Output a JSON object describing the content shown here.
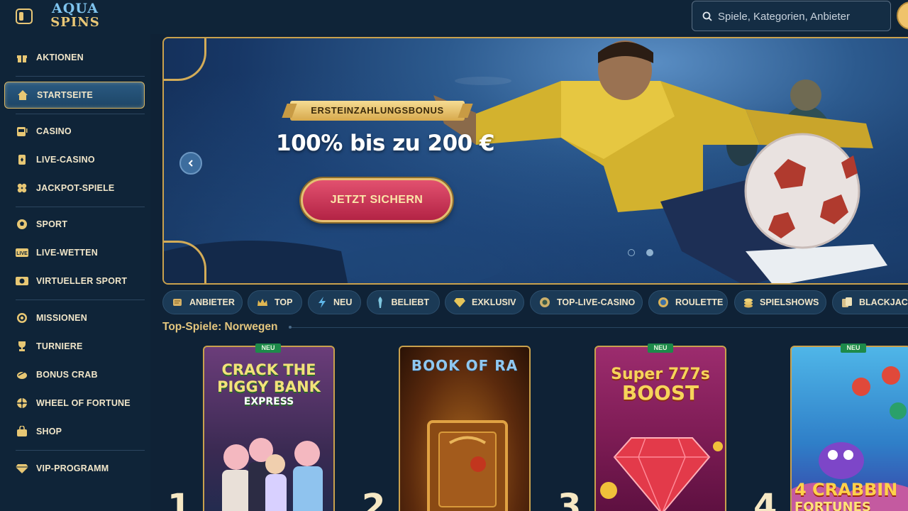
{
  "header": {
    "logo_line1": "AQUA",
    "logo_line2": "SPINS",
    "search_placeholder": "Spiele, Kategorien, Anbieter"
  },
  "sidebar": {
    "items": [
      {
        "label": "AKTIONEN",
        "icon": "gift-icon"
      },
      {
        "label": "STARTSEITE",
        "icon": "home-icon",
        "active": true
      },
      {
        "label": "CASINO",
        "icon": "slot-machine-icon"
      },
      {
        "label": "LIVE-CASINO",
        "icon": "card-icon"
      },
      {
        "label": "JACKPOT-SPIELE",
        "icon": "clover-icon"
      },
      {
        "label": "SPORT",
        "icon": "soccer-ball-icon"
      },
      {
        "label": "LIVE-WETTEN",
        "icon": "live-icon"
      },
      {
        "label": "VIRTUELLER SPORT",
        "icon": "screen-ball-icon"
      },
      {
        "label": "MISSIONEN",
        "icon": "target-icon"
      },
      {
        "label": "TURNIERE",
        "icon": "trophy-icon"
      },
      {
        "label": "BONUS CRAB",
        "icon": "claw-icon"
      },
      {
        "label": "WHEEL OF FORTUNE",
        "icon": "wheel-icon"
      },
      {
        "label": "SHOP",
        "icon": "bag-icon"
      },
      {
        "label": "VIP-PROGRAMM",
        "icon": "diamond-icon"
      }
    ]
  },
  "hero": {
    "badge": "ERSTEINZAHLUNGSBONUS",
    "title": "100% bis zu 200 €",
    "cta": "JETZT SICHERN",
    "slides": 2,
    "active_slide": 2
  },
  "tabs": [
    {
      "label": "ANBIETER",
      "icon": "scroll-icon"
    },
    {
      "label": "TOP",
      "icon": "crown-icon"
    },
    {
      "label": "NEU",
      "icon": "lightning-icon"
    },
    {
      "label": "BELIEBT",
      "icon": "torch-icon"
    },
    {
      "label": "EXKLUSIV",
      "icon": "gem-icon"
    },
    {
      "label": "TOP-LIVE-CASINO",
      "icon": "chip-icon"
    },
    {
      "label": "ROULETTE",
      "icon": "roulette-icon"
    },
    {
      "label": "SPIELSHOWS",
      "icon": "coins-icon"
    },
    {
      "label": "BLACKJACK",
      "icon": "cards-icon"
    }
  ],
  "section": {
    "title": "Top-Spiele: Norwegen"
  },
  "games": [
    {
      "rank": "1",
      "new": "NEU",
      "title_lines": [
        "CRACK THE",
        "PIGGY BANK",
        "EXPRESS"
      ]
    },
    {
      "rank": "2",
      "new": "",
      "title_lines": [
        "BOOK OF RA"
      ]
    },
    {
      "rank": "3",
      "new": "NEU",
      "title_lines": [
        "Super 777s",
        "BOOST"
      ]
    },
    {
      "rank": "4",
      "new": "NEU",
      "title_lines": [
        "4 CRABBIN",
        "FORTUNES"
      ]
    }
  ],
  "colors": {
    "gold": "#d9b664",
    "background": "#0f2236",
    "cta": "#c5304f"
  }
}
